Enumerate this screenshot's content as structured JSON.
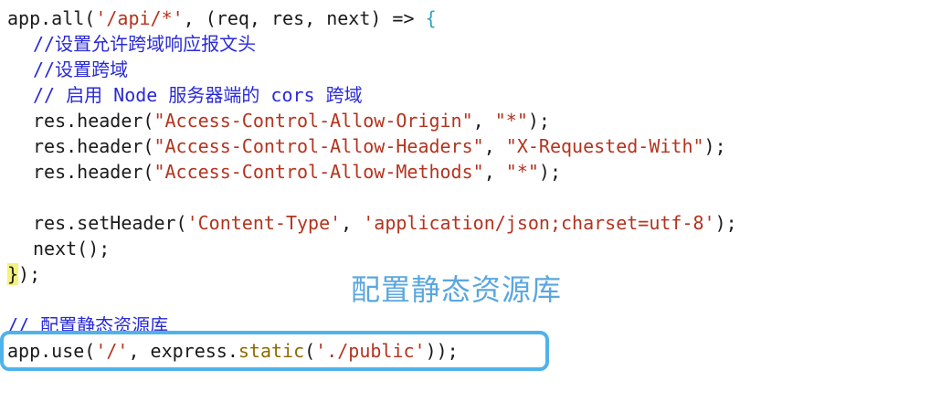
{
  "code": {
    "l1": {
      "a": "app.all(",
      "b": "'/api/*'",
      "c": ", (req, res, next) => ",
      "d": "{"
    },
    "l2": "//设置允许跨域响应报文头",
    "l3": "//设置跨域",
    "l4": "// 启用 Node 服务器端的 cors 跨域",
    "l5": {
      "a": "res.header(",
      "b": "\"Access-Control-Allow-Origin\"",
      "c": ", ",
      "d": "\"*\"",
      "e": ");"
    },
    "l6": {
      "a": "res.header(",
      "b": "\"Access-Control-Allow-Headers\"",
      "c": ", ",
      "d": "\"X-Requested-With\"",
      "e": ");"
    },
    "l7": {
      "a": "res.header(",
      "b": "\"Access-Control-Allow-Methods\"",
      "c": ", ",
      "d": "\"*\"",
      "e": ");"
    },
    "l8": {
      "a": "res.setHeader(",
      "b": "'Content-Type'",
      "c": ", ",
      "d": "'application/json;charset=utf-8'",
      "e": ");"
    },
    "l9": "next();",
    "l10": {
      "a": "}",
      "b": ");"
    },
    "l11": "// 配置静态资源库",
    "l12": {
      "a": "app.use(",
      "b": "'/'",
      "c": ", express.",
      "d": "static",
      "e": "(",
      "f": "'./public'",
      "g": "));"
    }
  },
  "annotation": "配置静态资源库",
  "colors": {
    "comment": "#2a2ad6",
    "string": "#b4331e",
    "method": "#8f6a00",
    "highlight_box": "#4fb3ea",
    "annotation_text": "#5aa7de",
    "brace_highlight": "#f4f27a"
  }
}
